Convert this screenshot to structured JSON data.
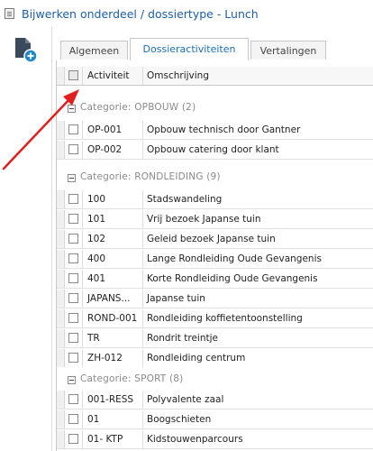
{
  "window": {
    "title": "Bijwerken onderdeel / dossiertype - Lunch"
  },
  "toolbar": {
    "add_icon": "add-document-icon"
  },
  "tabs": [
    {
      "label": "Algemeen",
      "active": false
    },
    {
      "label": "Dossieractiviteiten",
      "active": true
    },
    {
      "label": "Vertalingen",
      "active": false
    }
  ],
  "grid": {
    "columns": {
      "activity": "Activiteit",
      "description": "Omschrijving"
    },
    "categories": [
      {
        "label": "Categorie:  OPBOUW (2)",
        "rows": [
          {
            "code": "OP-001",
            "description": "Opbouw technisch door Gantner"
          },
          {
            "code": "OP-002",
            "description": "Opbouw catering door klant"
          }
        ]
      },
      {
        "label": "Categorie:  RONDLEIDING (9)",
        "rows": [
          {
            "code": "100",
            "description": "Stadswandeling"
          },
          {
            "code": "101",
            "description": "Vrij bezoek Japanse tuin"
          },
          {
            "code": "102",
            "description": "Geleid bezoek Japanse tuin"
          },
          {
            "code": "400",
            "description": "Lange Rondleiding Oude Gevangenis"
          },
          {
            "code": "401",
            "description": "Korte Rondleiding Oude Gevangenis"
          },
          {
            "code": "JAPANS...",
            "description": "Japanse tuin"
          },
          {
            "code": "ROND-001",
            "description": "Rondleiding koffietentoonstelling"
          },
          {
            "code": "TR",
            "description": "Rondrit treintje"
          },
          {
            "code": "ZH-012",
            "description": "Rondleiding centrum"
          }
        ]
      },
      {
        "label": "Categorie:  SPORT (8)",
        "rows": [
          {
            "code": "001-RESS",
            "description": "Polyvalente zaal"
          },
          {
            "code": "01",
            "description": "Boogschieten"
          },
          {
            "code": "01- KTP",
            "description": "Kidstouwenparcours"
          }
        ]
      }
    ]
  },
  "colors": {
    "title": "#1e5fa8",
    "active_tab": "#1a6fb5",
    "arrow": "#e02020",
    "icon": "#3a4a5c"
  }
}
